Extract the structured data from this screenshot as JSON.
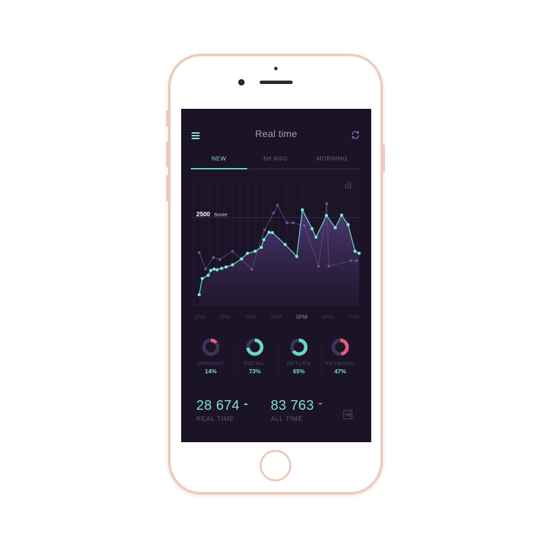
{
  "header": {
    "title": "Real time"
  },
  "tabs": [
    {
      "label": "NEW",
      "active": true
    },
    {
      "label": "5H AGO",
      "active": false
    },
    {
      "label": "MORNING",
      "active": false
    }
  ],
  "icons": {
    "menu": "hamburger-menu-icon",
    "refresh": "refresh-icon",
    "chart_toggle": "bar-chart-icon",
    "export": "export-icon"
  },
  "colors": {
    "background": "#1b1427",
    "accent": "#7fe0cf",
    "secondary": "#8a6cc4",
    "negative": "#e85a85",
    "muted": "#5e5778"
  },
  "chart_data": {
    "type": "line",
    "x": [
      "1PM",
      "2PM",
      "3PM",
      "4PM",
      "5PM",
      "6PM",
      "7PM"
    ],
    "highlight_x": "5PM",
    "annotation": {
      "value": "2500",
      "unit": "Score"
    },
    "series": [
      {
        "points": [
          [
            0.0,
            300
          ],
          [
            0.12,
            760
          ],
          [
            0.35,
            850
          ],
          [
            0.45,
            990
          ],
          [
            0.58,
            1030
          ],
          [
            0.7,
            1010
          ],
          [
            0.87,
            1050
          ],
          [
            1.05,
            1090
          ],
          [
            1.3,
            1150
          ],
          [
            1.65,
            1320
          ],
          [
            1.88,
            1480
          ],
          [
            2.18,
            1540
          ],
          [
            2.42,
            1650
          ],
          [
            2.52,
            1870
          ],
          [
            2.72,
            2080
          ],
          [
            2.85,
            2070
          ],
          [
            3.35,
            1730
          ],
          [
            3.8,
            1390
          ],
          [
            4.02,
            2720
          ],
          [
            4.4,
            2180
          ],
          [
            4.55,
            1940
          ],
          [
            4.96,
            2560
          ],
          [
            5.3,
            2210
          ],
          [
            5.55,
            2570
          ],
          [
            5.8,
            2300
          ],
          [
            6.07,
            1540
          ],
          [
            6.23,
            1480
          ]
        ]
      },
      {
        "points": [
          [
            0.0,
            1500
          ],
          [
            0.25,
            1030
          ],
          [
            0.55,
            1360
          ],
          [
            0.8,
            1300
          ],
          [
            1.3,
            1540
          ],
          [
            2.05,
            1020
          ],
          [
            2.55,
            2150
          ],
          [
            2.9,
            2630
          ],
          [
            3.05,
            2850
          ],
          [
            3.42,
            2350
          ],
          [
            3.65,
            2350
          ],
          [
            4.1,
            2270
          ],
          [
            4.65,
            1110
          ],
          [
            4.97,
            2900
          ],
          [
            5.05,
            1110
          ],
          [
            5.92,
            1270
          ],
          [
            6.13,
            1270
          ]
        ]
      }
    ],
    "y_range": [
      0,
      3600
    ],
    "x_range": [
      -0.3,
      6.3
    ]
  },
  "donuts": [
    {
      "label": "ORGANIC",
      "value": "14%",
      "pct": 0.14,
      "color": "#e85a85"
    },
    {
      "label": "SOCIAL.",
      "value": "73%",
      "pct": 0.73,
      "color": "#6bd8c6"
    },
    {
      "label": "RETURN",
      "value": "65%",
      "pct": 0.65,
      "color": "#6bd8c6"
    },
    {
      "label": "KEYWORD",
      "value": "47%",
      "pct": 0.47,
      "color": "#e85a85"
    }
  ],
  "stats": {
    "real_time": {
      "value": "28 674",
      "label": "REAL TIME",
      "trend": "up"
    },
    "all_time": {
      "value": "83 763",
      "label": "ALL TIME",
      "trend": "down"
    }
  }
}
